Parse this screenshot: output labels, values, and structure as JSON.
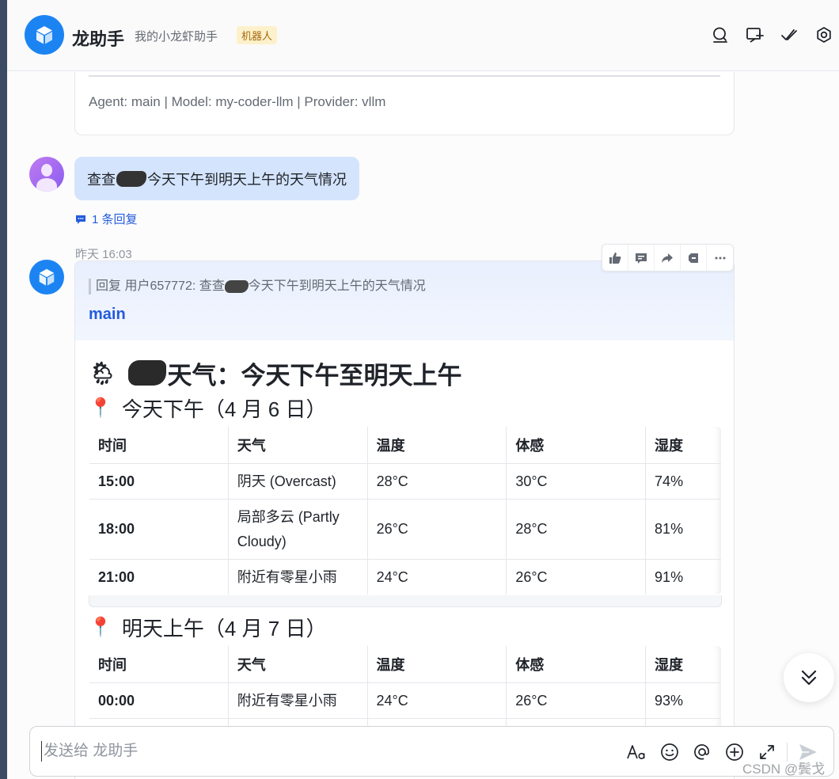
{
  "header": {
    "title": "龙助手",
    "subtitle": "我的小龙虾助手",
    "badge": "机器人",
    "icons": [
      "search-icon",
      "new-chat-icon",
      "check-icon",
      "settings-icon"
    ]
  },
  "previous_message": {
    "meta": "Agent: main | Model: my-coder-llm | Provider: vllm"
  },
  "user_message": {
    "text_before": "查查",
    "text_after": "今天下午到明天上午的天气情况",
    "reply_count": "1 条回复"
  },
  "bot_message": {
    "timestamp": "昨天 16:03",
    "reply_quote_before": "回复 用户657772:  查查",
    "reply_quote_after": "今天下午到明天上午的天气情况",
    "agent": "main",
    "heading_suffix": "天气：今天下午至明天上午",
    "section1_title": "今天下午（4 月 6 日）",
    "section2_title": "明天上午（4 月 7 日）",
    "columns": [
      "时间",
      "天气",
      "温度",
      "体感",
      "湿度"
    ],
    "table1": [
      {
        "time": "15:00",
        "weather": "阴天 (Overcast)",
        "temp": "28°C",
        "feels": "30°C",
        "humidity": "74%"
      },
      {
        "time": "18:00",
        "weather": "局部多云 (Partly Cloudy)",
        "temp": "26°C",
        "feels": "28°C",
        "humidity": "81%"
      },
      {
        "time": "21:00",
        "weather": "附近有零星小雨",
        "temp": "24°C",
        "feels": "26°C",
        "humidity": "91%"
      }
    ],
    "table2": [
      {
        "time": "00:00",
        "weather": "附近有零星小雨",
        "temp": "24°C",
        "feels": "26°C",
        "humidity": "93%"
      }
    ],
    "actions": [
      "thumbs-up-icon",
      "comment-icon",
      "forward-icon",
      "collapse-icon",
      "more-icon"
    ]
  },
  "composer": {
    "placeholder": "发送给 龙助手"
  },
  "watermark": "CSDN @鬓戈",
  "colors": {
    "brand": "#1c84f2",
    "link": "#245bdb",
    "user_bubble": "#d4e4fc",
    "pin": "#e0284a"
  }
}
